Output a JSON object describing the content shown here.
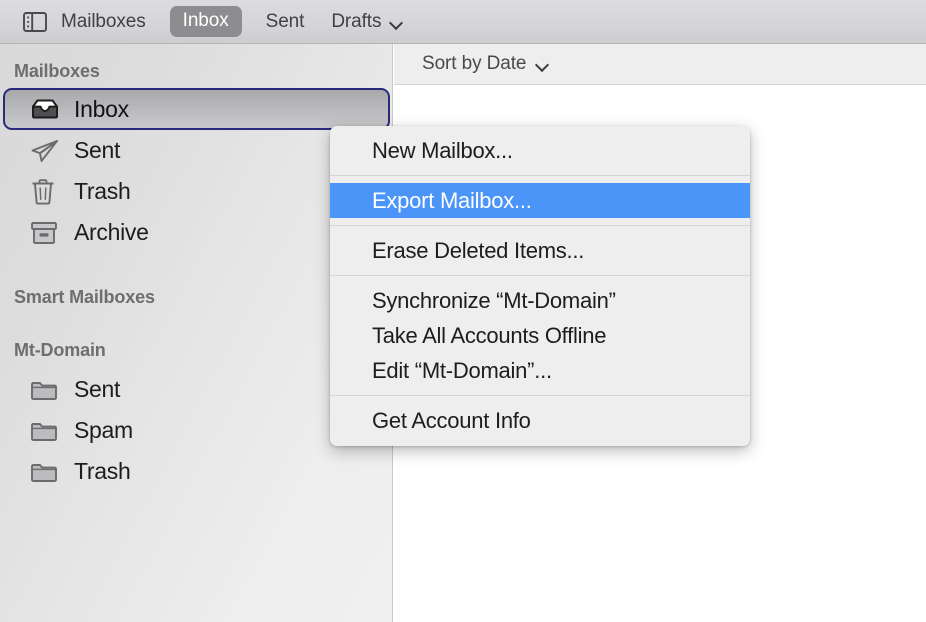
{
  "toolbar": {
    "sidebar_toggle_icon": "sidebar-panel-icon",
    "mailboxes_label": "Mailboxes",
    "inbox_label": "Inbox",
    "sent_label": "Sent",
    "drafts_label": "Drafts",
    "drafts_chevron_icon": "chevron-down-icon"
  },
  "sidebar": {
    "headers": {
      "mailboxes": "Mailboxes",
      "smart_mailboxes": "Smart Mailboxes",
      "account": "Mt-Domain"
    },
    "mailboxes": [
      {
        "label": "Inbox",
        "icon": "inbox-tray-icon",
        "selected": true
      },
      {
        "label": "Sent",
        "icon": "paper-plane-icon",
        "selected": false
      },
      {
        "label": "Trash",
        "icon": "trash-can-icon",
        "selected": false
      },
      {
        "label": "Archive",
        "icon": "archive-box-icon",
        "selected": false
      }
    ],
    "account_folders": [
      {
        "label": "Sent",
        "icon": "folder-icon"
      },
      {
        "label": "Spam",
        "icon": "folder-icon"
      },
      {
        "label": "Trash",
        "icon": "folder-icon"
      }
    ]
  },
  "main": {
    "sort_label": "Sort by Date",
    "sort_chevron_icon": "chevron-down-icon"
  },
  "context_menu": {
    "items": [
      {
        "label": "New Mailbox...",
        "highlighted": false
      },
      {
        "label": "Export Mailbox...",
        "highlighted": true
      },
      {
        "label": "Erase Deleted Items...",
        "highlighted": false
      },
      {
        "label": "Synchronize “Mt-Domain”",
        "highlighted": false
      },
      {
        "label": "Take All Accounts Offline",
        "highlighted": false
      },
      {
        "label": "Edit “Mt-Domain”...",
        "highlighted": false
      },
      {
        "label": "Get Account Info",
        "highlighted": false
      }
    ]
  },
  "colors": {
    "highlight": "#4a95f7",
    "focus_ring": "#2a2a7a",
    "toolbar_pill": "#8d8d90",
    "menu_bg": "#eeeeee"
  }
}
